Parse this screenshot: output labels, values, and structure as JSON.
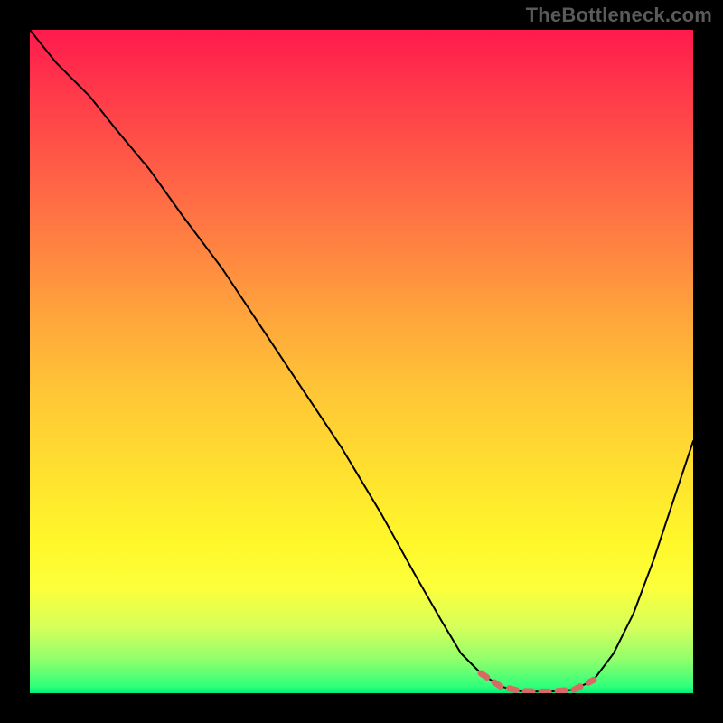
{
  "watermark": "TheBottleneck.com",
  "chart_data": {
    "type": "line",
    "title": "",
    "xlabel": "",
    "ylabel": "",
    "xlim": [
      0,
      100
    ],
    "ylim": [
      0,
      100
    ],
    "grid": false,
    "legend": false,
    "series": [
      {
        "name": "bottleneck-curve",
        "color": "#000000",
        "points": [
          {
            "x": 0,
            "y": 100
          },
          {
            "x": 4,
            "y": 95
          },
          {
            "x": 9,
            "y": 90
          },
          {
            "x": 13,
            "y": 85
          },
          {
            "x": 18,
            "y": 79
          },
          {
            "x": 23,
            "y": 72
          },
          {
            "x": 29,
            "y": 64
          },
          {
            "x": 35,
            "y": 55
          },
          {
            "x": 41,
            "y": 46
          },
          {
            "x": 47,
            "y": 37
          },
          {
            "x": 53,
            "y": 27
          },
          {
            "x": 58,
            "y": 18
          },
          {
            "x": 62,
            "y": 11
          },
          {
            "x": 65,
            "y": 6
          },
          {
            "x": 68,
            "y": 3
          },
          {
            "x": 71,
            "y": 1
          },
          {
            "x": 74,
            "y": 0.3
          },
          {
            "x": 78,
            "y": 0.2
          },
          {
            "x": 82,
            "y": 0.5
          },
          {
            "x": 85,
            "y": 2
          },
          {
            "x": 88,
            "y": 6
          },
          {
            "x": 91,
            "y": 12
          },
          {
            "x": 94,
            "y": 20
          },
          {
            "x": 97,
            "y": 29
          },
          {
            "x": 100,
            "y": 38
          }
        ]
      },
      {
        "name": "optimal-band",
        "color": "#d86a65",
        "points": [
          {
            "x": 68,
            "y": 3
          },
          {
            "x": 71,
            "y": 1
          },
          {
            "x": 74,
            "y": 0.3
          },
          {
            "x": 78,
            "y": 0.2
          },
          {
            "x": 82,
            "y": 0.5
          },
          {
            "x": 85,
            "y": 2
          }
        ]
      }
    ],
    "gradient_stops": [
      {
        "pos": 0.0,
        "color": "#ff1a4d"
      },
      {
        "pos": 0.2,
        "color": "#ff5a47"
      },
      {
        "pos": 0.42,
        "color": "#ffa13c"
      },
      {
        "pos": 0.67,
        "color": "#ffe12f"
      },
      {
        "pos": 0.84,
        "color": "#fcff3a"
      },
      {
        "pos": 0.95,
        "color": "#8fff6c"
      },
      {
        "pos": 1.0,
        "color": "#00f07a"
      }
    ]
  }
}
